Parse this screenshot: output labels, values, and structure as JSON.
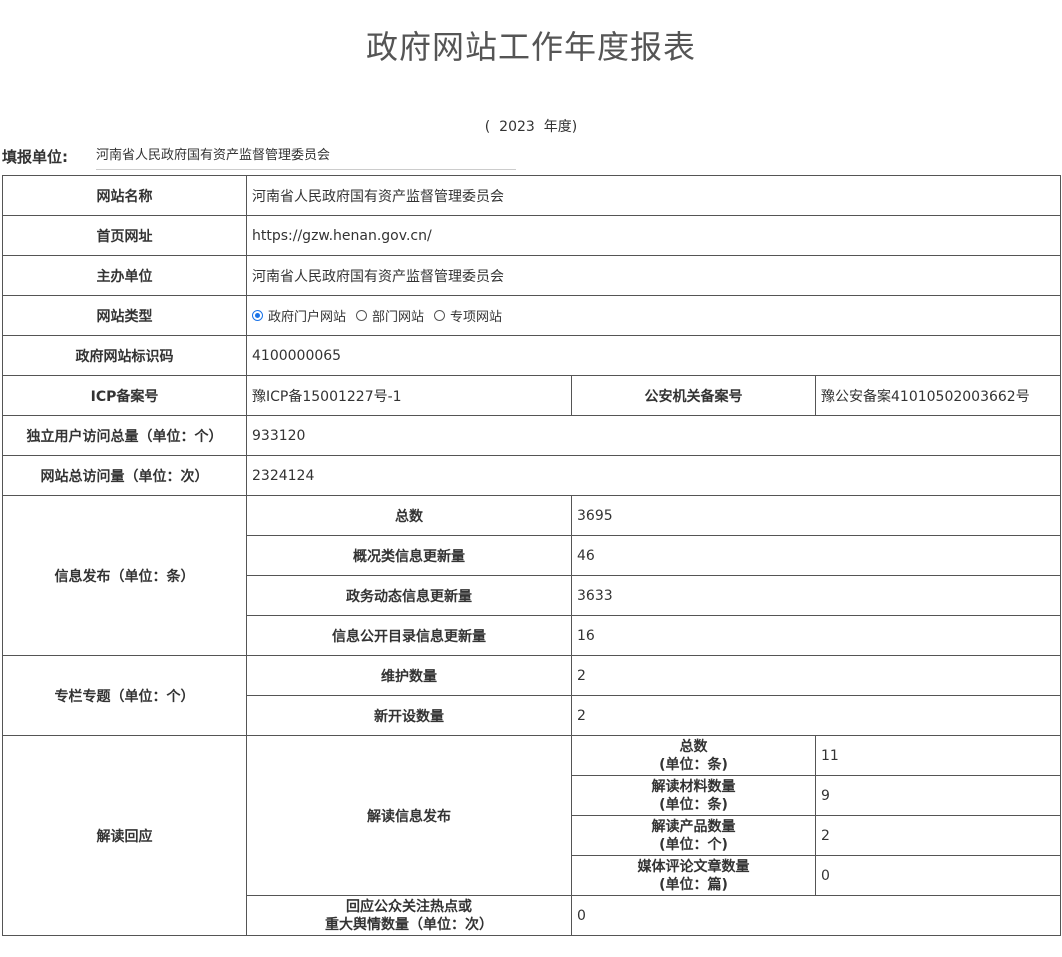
{
  "title": "政府网站工作年度报表",
  "year": {
    "open": "(",
    "value": "2023",
    "suffix": "年度)"
  },
  "filler": {
    "label": "填报单位:",
    "value": "河南省人民政府国有资产监督管理委员会"
  },
  "rows": {
    "site_name": {
      "label": "网站名称",
      "value": "河南省人民政府国有资产监督管理委员会"
    },
    "homepage": {
      "label": "首页网址",
      "value": "https://gzw.henan.gov.cn/"
    },
    "sponsor": {
      "label": "主办单位",
      "value": "河南省人民政府国有资产监督管理委员会"
    },
    "site_type": {
      "label": "网站类型",
      "options": [
        "政府门户网站",
        "部门网站",
        "专项网站"
      ],
      "selected": "政府门户网站"
    },
    "site_id": {
      "label": "政府网站标识码",
      "value": "4100000065"
    },
    "icp": {
      "label": "ICP备案号",
      "value": "豫ICP备15001227号-1"
    },
    "police": {
      "label": "公安机关备案号",
      "value": "豫公安备案41010502003662号"
    },
    "unique_visitors": {
      "label": "独立用户访问总量（单位：个）",
      "value": "933120"
    },
    "total_visits": {
      "label": "网站总访问量（单位：次）",
      "value": "2324124"
    }
  },
  "info_release": {
    "label": "信息发布（单位：条）",
    "items": [
      {
        "label": "总数",
        "value": "3695"
      },
      {
        "label": "概况类信息更新量",
        "value": "46"
      },
      {
        "label": "政务动态信息更新量",
        "value": "3633"
      },
      {
        "label": "信息公开目录信息更新量",
        "value": "16"
      }
    ]
  },
  "columns": {
    "label": "专栏专题（单位：个）",
    "items": [
      {
        "label": "维护数量",
        "value": "2"
      },
      {
        "label": "新开设数量",
        "value": "2"
      }
    ]
  },
  "interpretation": {
    "label": "解读回应",
    "release_label": "解读信息发布",
    "items": [
      {
        "label_line1": "总数",
        "label_line2": "(单位：条)",
        "value": "11"
      },
      {
        "label_line1": "解读材料数量",
        "label_line2": "(单位：条)",
        "value": "9"
      },
      {
        "label_line1": "解读产品数量",
        "label_line2": "(单位：个)",
        "value": "2"
      },
      {
        "label_line1": "媒体评论文章数量",
        "label_line2": "(单位：篇)",
        "value": "0"
      }
    ],
    "response": {
      "label_line1": "回应公众关注热点或",
      "label_line2": "重大舆情数量（单位：次）",
      "value": "0"
    }
  }
}
